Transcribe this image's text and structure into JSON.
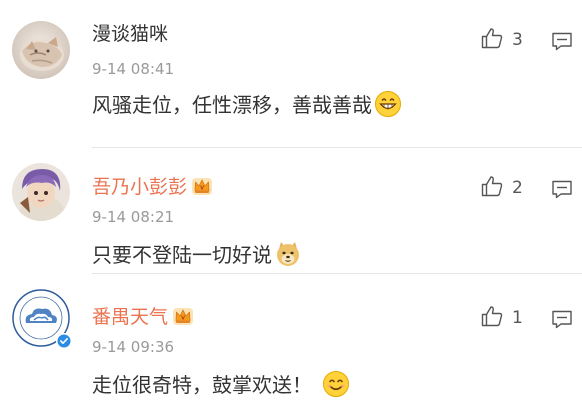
{
  "comments": [
    {
      "username": "漫谈猫咪",
      "timestamp": "9-14 08:41",
      "text": "风骚走位，任性漂移，善哉善哉",
      "likes": "3",
      "vip": false,
      "emoji": "grinning-face",
      "avatar": "cat-photo"
    },
    {
      "username": "吾乃小彭彭",
      "timestamp": "9-14 08:21",
      "text": "只要不登陆一切好说",
      "likes": "2",
      "vip": true,
      "emoji": "doge-face",
      "avatar": "anime-character"
    },
    {
      "username": "番禺天气",
      "timestamp": "9-14 09:36",
      "text": "走位很奇特，鼓掌欢送！",
      "likes": "1",
      "vip": true,
      "verified": true,
      "emoji": "smiling-face",
      "avatar": "weather-bureau-logo"
    }
  ],
  "colors": {
    "vip_name": "#eb7350",
    "normal_name": "#333333",
    "timestamp": "#9a9a9a",
    "verified_badge": "#2b8ce6"
  }
}
